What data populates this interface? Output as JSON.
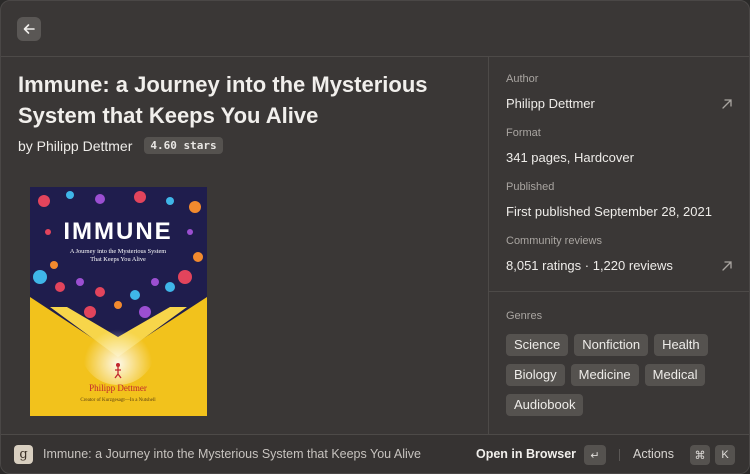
{
  "book": {
    "title": "Immune: a Journey into the Mysterious System that Keeps You Alive",
    "byline": "by Philipp Dettmer",
    "rating_badge": "4.60 stars"
  },
  "cover": {
    "title": "IMMUNE",
    "subtitle_line1": "A Journey into the Mysterious System",
    "subtitle_line2": "That Keeps You Alive",
    "author": "Philipp Dettmer",
    "tagline": "Creator of Kurzgesagt—In a Nutshell",
    "colors": {
      "background": "#1f1d4d",
      "burst": "#f2c21c",
      "title": "#ffffff"
    }
  },
  "sidebar": {
    "author_label": "Author",
    "author_value": "Philipp Dettmer",
    "format_label": "Format",
    "format_value": "341 pages, Hardcover",
    "published_label": "Published",
    "published_value": "First published September 28, 2021",
    "reviews_label": "Community reviews",
    "reviews_value": "8,051 ratings · 1,220 reviews",
    "genres_label": "Genres",
    "genres": [
      "Science",
      "Nonfiction",
      "Health",
      "Biology",
      "Medicine",
      "Medical",
      "Audiobook"
    ]
  },
  "bottombar": {
    "app_icon_letter": "g",
    "title": "Immune: a Journey into the Mysterious System that Keeps You Alive",
    "primary_action": "Open in Browser",
    "primary_key": "↵",
    "actions_label": "Actions",
    "actions_key_mod": "⌘",
    "actions_key": "K"
  },
  "icons": {
    "back": "arrow-left-icon",
    "external": "arrow-up-right-icon",
    "app": "goodreads-icon"
  }
}
